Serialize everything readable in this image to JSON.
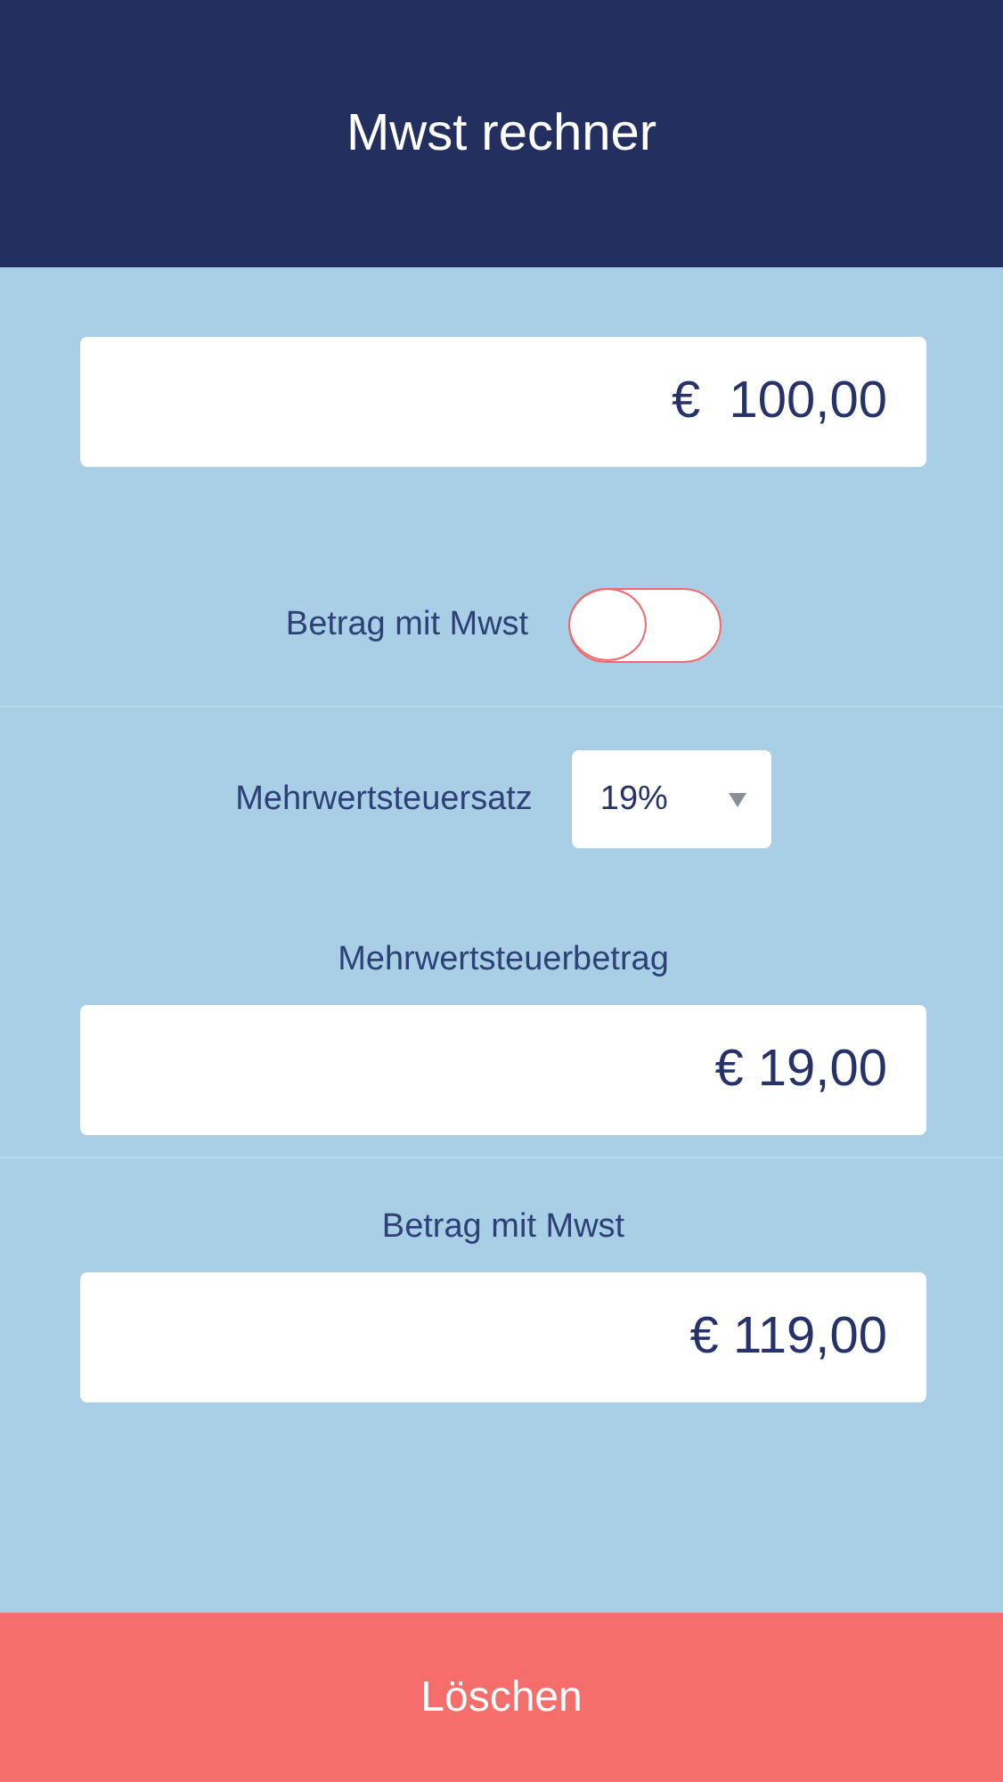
{
  "header": {
    "title": "Mwst rechner"
  },
  "amount_field": {
    "value": "€  100,00"
  },
  "toggle": {
    "label": "Betrag mit Mwst",
    "on": false
  },
  "rate": {
    "label": "Mehrwertsteuersatz",
    "value": "19%"
  },
  "results": [
    {
      "label": "Mehrwertsteuerbetrag",
      "value": "€ 19,00"
    },
    {
      "label": "Betrag mit Mwst",
      "value": "€ 119,00"
    }
  ],
  "clear_button": {
    "label": "Löschen"
  }
}
